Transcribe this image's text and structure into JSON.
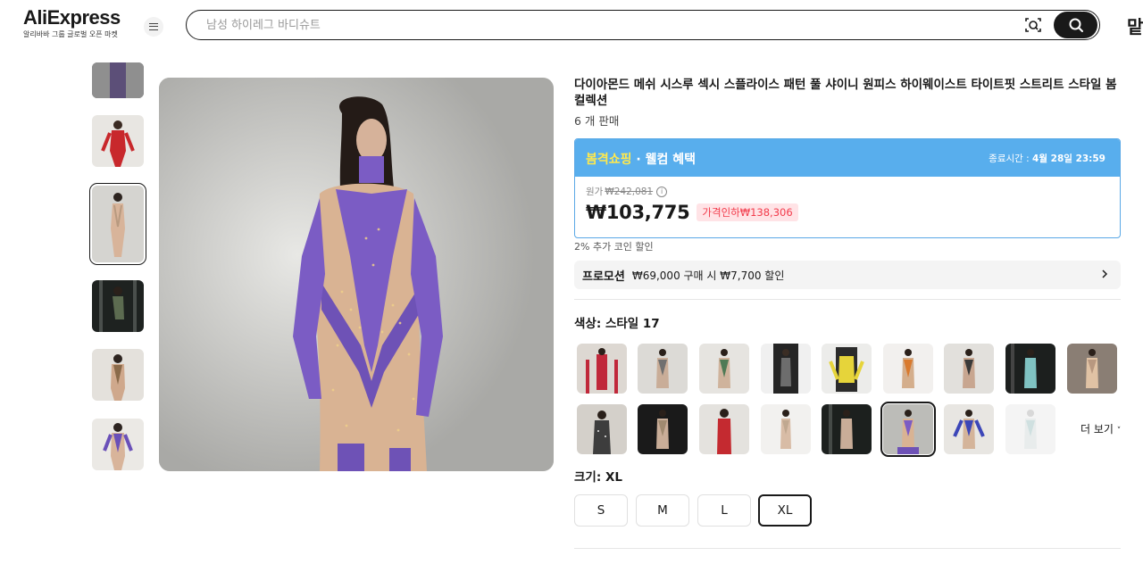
{
  "header": {
    "logo_text": "AliExpress",
    "logo_sub": "알리바바 그룹 글로벌 오픈 마켓",
    "search_placeholder": "남성 하이레그 바디슈트",
    "cut_text": "맡"
  },
  "product": {
    "title": "다이아몬드 메쉬 시스루 섹시 스플라이스 패턴 풀 샤이니 원피스 하이웨이스트 타이트핏 스트리트 스타일 봄 컬렉션",
    "sold": "6 개 판매"
  },
  "promo_card": {
    "highlight": "봄격쇼핑",
    "rest": " · 웰컴 혜택",
    "end_label": "종료시간 : ",
    "end_time": "4월 28일 23:59",
    "orig_label": "원가",
    "orig_price": "₩242,081",
    "price": "₩103,775",
    "discount": "가격인하₩138,306"
  },
  "coin_text": "2% 추가 코인 할인",
  "promotion": {
    "label": "프로모션",
    "desc": "₩69,000 구매 시 ₩7,700 할인"
  },
  "color": {
    "label": "색상: 스타일 17",
    "more": "더 보기",
    "selected_index": 14
  },
  "size": {
    "label": "크기: XL",
    "options": [
      "S",
      "M",
      "L",
      "XL"
    ],
    "selected": "XL"
  },
  "colors": {
    "accent_blue": "#58aeed",
    "highlight_yellow": "#ffe94d",
    "price_red": "#f23b4b",
    "suit_purple": "#7b5cc4"
  }
}
